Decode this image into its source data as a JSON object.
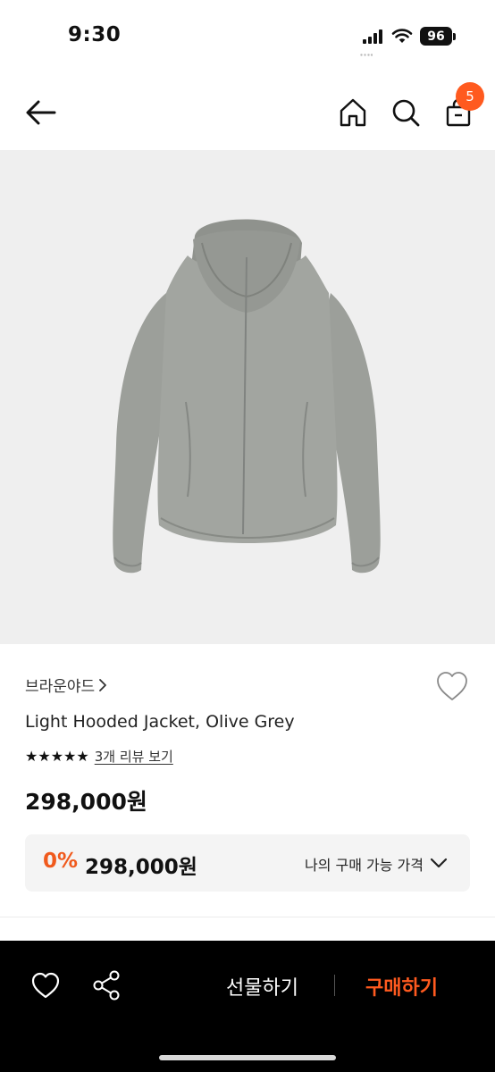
{
  "status_bar": {
    "time": "9:30",
    "battery": "96"
  },
  "header": {
    "cart_count": "5"
  },
  "product": {
    "brand": "브라운야드",
    "name": "Light Hooded Jacket, Olive Grey",
    "stars": "★★★★★",
    "review_link": "3개 리뷰 보기",
    "price": "298,000원",
    "my_price": {
      "discount": "0%",
      "price": "298,000원",
      "label": "나의 구매 가능 가격"
    }
  },
  "bottom_bar": {
    "gift_label": "선물하기",
    "buy_label": "구매하기"
  },
  "colors": {
    "accent": "#ff5a1f",
    "image_bg": "#efefef",
    "jacket": "#9a9d98"
  }
}
